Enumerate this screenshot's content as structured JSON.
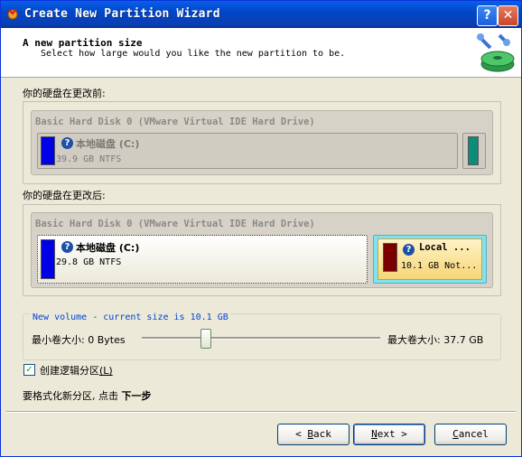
{
  "window": {
    "title": "Create New Partition Wizard"
  },
  "header": {
    "title": "A new partition size",
    "subtitle": "Select how large would you like the new partition to be."
  },
  "before": {
    "label": "你的硬盘在更改前:",
    "disk_title": "Basic Hard Disk 0 (VMware Virtual IDE Hard Drive)",
    "partition": {
      "name": "本地磁盘 (C:)",
      "info": "39.9 GB NTFS"
    }
  },
  "after": {
    "label": "你的硬盘在更改后:",
    "disk_title": "Basic Hard Disk 0 (VMware Virtual IDE Hard Drive)",
    "partition": {
      "name": "本地磁盘 (C:)",
      "info": "29.8 GB NTFS"
    },
    "new_partition": {
      "name": "Local ...",
      "info": "10.1 GB Not..."
    }
  },
  "sizer": {
    "caption": "New volume - current size is 10.1 GB",
    "min_label": "最小卷大小: 0 Bytes",
    "max_label": "最大卷大小: 37.7 GB",
    "current_size_gb": 10.1,
    "max_size_gb": 37.7
  },
  "logical": {
    "label": "创建逻辑分区",
    "accel": "(L)",
    "checked": true
  },
  "hint": {
    "prefix": "要格式化新分区, 点击 ",
    "bold": "下一步"
  },
  "buttons": {
    "back": {
      "accel": "B",
      "rest": "ack"
    },
    "next": {
      "accel": "N",
      "rest": "ext"
    },
    "cancel": {
      "accel": "C",
      "rest": "ancel"
    }
  },
  "colors": {
    "title_bar": "#0a5fe8",
    "partition_primary": "#0000e6",
    "partition_unallocated": "#0e8c7a",
    "partition_new": "#7a0000",
    "selected_highlight": "#7fe3f0"
  }
}
